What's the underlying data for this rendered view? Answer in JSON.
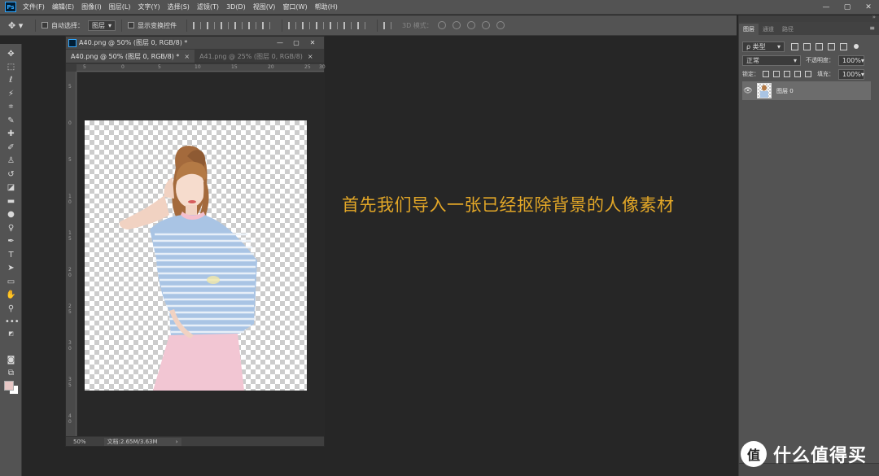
{
  "app": {
    "logo": "Ps"
  },
  "menu": [
    "文件(F)",
    "编辑(E)",
    "图像(I)",
    "图层(L)",
    "文字(Y)",
    "选择(S)",
    "滤镜(T)",
    "3D(D)",
    "视图(V)",
    "窗口(W)",
    "帮助(H)"
  ],
  "window_controls": {
    "minimize": "—",
    "restore": "▢",
    "close": "✕"
  },
  "options": {
    "move_icon": "move-icon",
    "auto_select_label": "自动选择：",
    "auto_select_value": "图层",
    "show_transform_label": "显示变换控件",
    "mode3d_label": "3D 模式："
  },
  "document": {
    "title": "A40.png @ 50% (图层 0, RGB/8) *",
    "buttons": {
      "minimize": "—",
      "maximize": "▢",
      "close": "✕"
    },
    "tabs": [
      {
        "label": "A40.png @ 50% (图层 0, RGB/8) *",
        "close": "×"
      },
      {
        "label": "A41.png @ 25% (图层 0, RGB/8)",
        "close": "×"
      }
    ],
    "ruler_h": [
      "5",
      "0",
      "5",
      "10",
      "15",
      "20",
      "25",
      "30"
    ],
    "ruler_v": [
      "5",
      "0",
      "5",
      "1 0",
      "1 5",
      "2 0",
      "2 5",
      "3 0",
      "3 5",
      "4 0"
    ],
    "status": {
      "zoom": "50%",
      "doc_info": "文档:2.65M/3.63M",
      "arrow": "›"
    }
  },
  "caption": "首先我们导入一张已经抠除背景的人像素材",
  "layers_panel": {
    "collapse": "»",
    "tabs": [
      "图层",
      "通道",
      "路径"
    ],
    "menu_icon": "≡",
    "filter_label": "ρ 类型",
    "blend_mode": "正常",
    "opacity_label": "不透明度：",
    "opacity_value": "100%",
    "lock_label": "锁定：",
    "fill_label": "填充：",
    "fill_value": "100%",
    "layers": [
      {
        "name": "图层 0",
        "visible": true
      }
    ]
  },
  "watermark": {
    "logo": "值",
    "text": "什么值得买"
  },
  "colors": {
    "foreground": "#e7c7c5",
    "background": "#ffffff",
    "caption": "#e3a727"
  }
}
